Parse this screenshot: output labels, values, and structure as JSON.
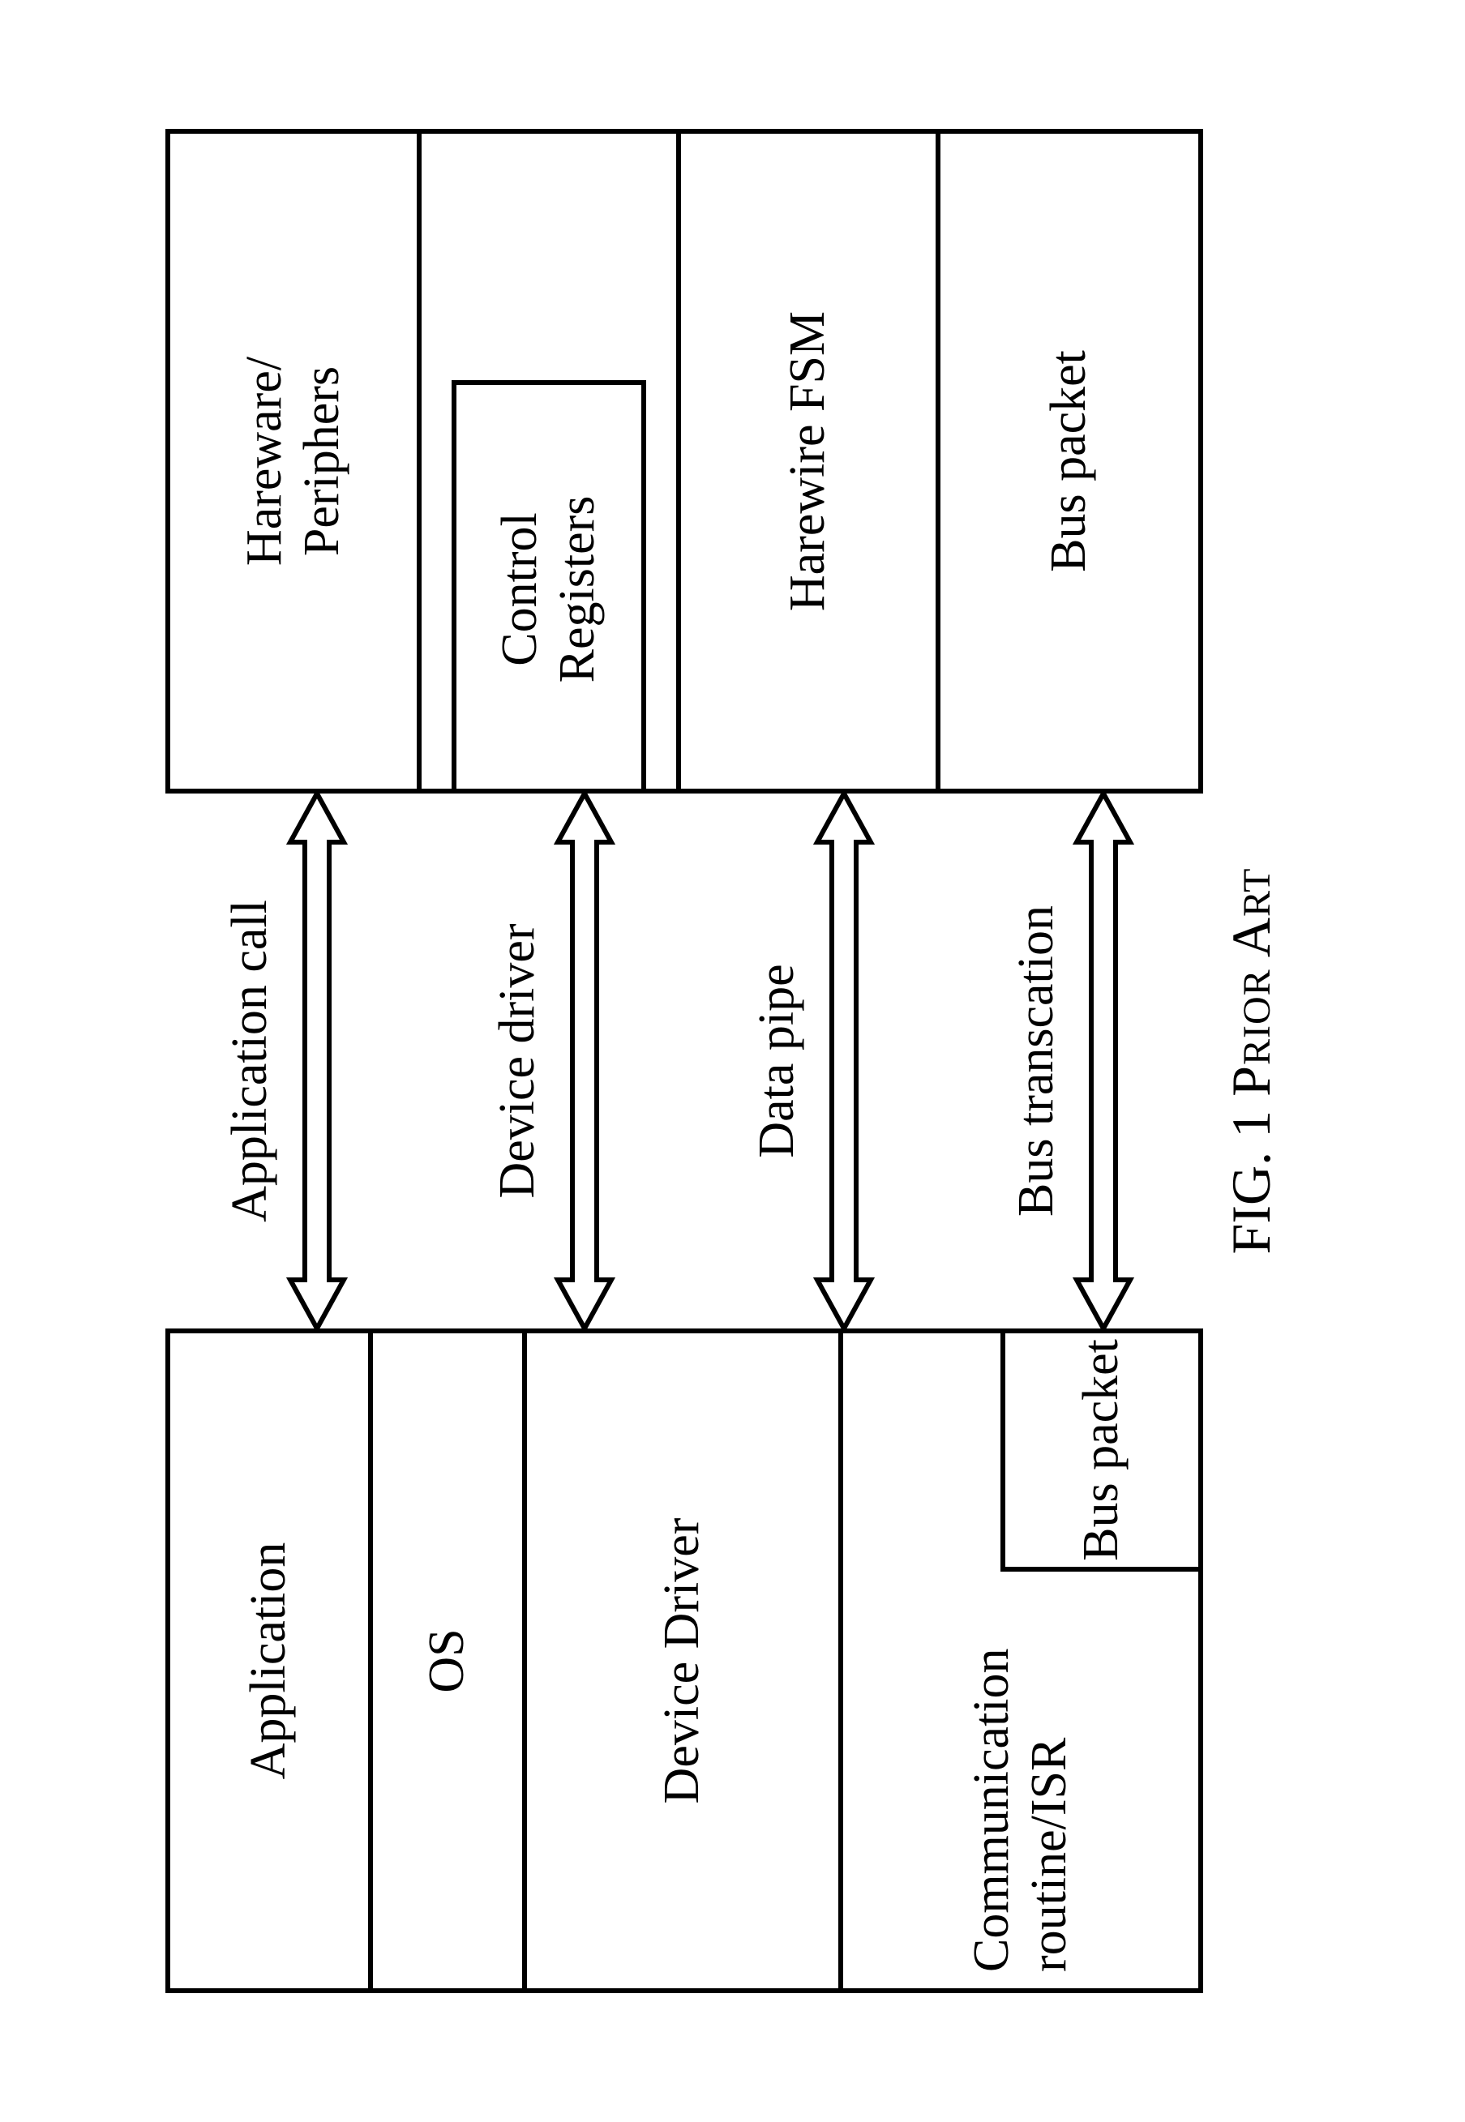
{
  "left": {
    "application": "Application",
    "os": "OS",
    "device_driver": "Device Driver",
    "comm_routine": "Communication routine/ISR",
    "bus_packet": "Bus packet"
  },
  "right": {
    "hardware_periphers": "Hareware/\nPeriphers",
    "control_registers": "Control Registers",
    "harewire_fsm": "Harewire FSM",
    "bus_packet": "Bus packet"
  },
  "arrows": {
    "application_call": "Application call",
    "device_driver": "Device driver",
    "data_pipe": "Data pipe",
    "bus_transaction": "Bus transcation"
  },
  "caption": {
    "fig": "FIG. 1 ",
    "prior_art": "Prior Art"
  }
}
